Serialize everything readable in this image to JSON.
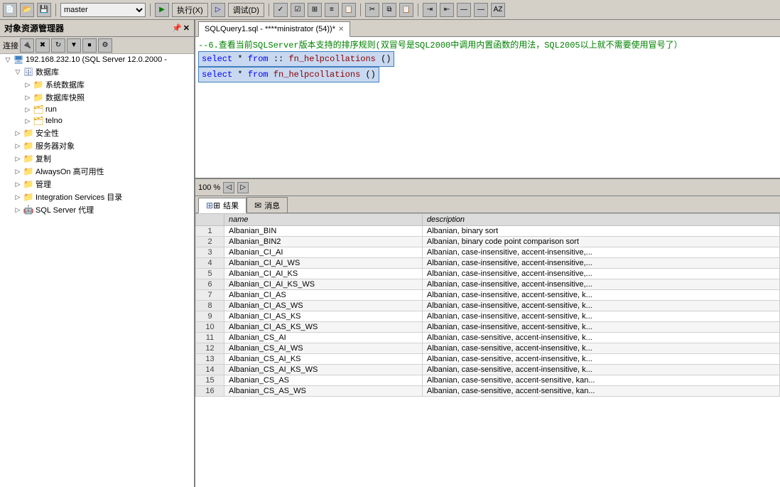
{
  "toolbar": {
    "db_select_value": "master",
    "execute_label": "执行(X)",
    "debug_label": "调试(D)"
  },
  "object_explorer": {
    "title": "对象资源管理器",
    "connect_label": "连接",
    "server": {
      "name": "192.168.232.10 (SQL Server 12.0.2000 -",
      "children": [
        {
          "label": "数据库",
          "expanded": true,
          "children": [
            {
              "label": "系统数据库",
              "expanded": false
            },
            {
              "label": "数据库快照",
              "expanded": false
            },
            {
              "label": "run",
              "expanded": false
            },
            {
              "label": "telno",
              "expanded": false
            }
          ]
        },
        {
          "label": "安全性",
          "expanded": false
        },
        {
          "label": "服务器对象",
          "expanded": false
        },
        {
          "label": "复制",
          "expanded": false
        },
        {
          "label": "AlwaysOn 高可用性",
          "expanded": false
        },
        {
          "label": "管理",
          "expanded": false
        },
        {
          "label": "Integration Services 目录",
          "expanded": false
        },
        {
          "label": "SQL Server 代理",
          "expanded": false
        }
      ]
    }
  },
  "editor": {
    "tab_label": "SQLQuery1.sql - ****ministrator (54))*",
    "comment_line": "--6.查看当前SQLServer版本支持的排序规则(双冒号是SQL2000中调用内置函数的用法，SQL2005以上就不需要使用冒号了）",
    "line1": "select * from ::fn_helpcollations()",
    "line2": "select * from fn_helpcollations()",
    "zoom": "100 %"
  },
  "results": {
    "tab_results": "结果",
    "tab_messages": "消息",
    "columns": {
      "row_num": "",
      "name": "name",
      "description": "description"
    },
    "rows": [
      {
        "num": "1",
        "name": "Albanian_BIN",
        "description": "Albanian, binary sort"
      },
      {
        "num": "2",
        "name": "Albanian_BIN2",
        "description": "Albanian, binary code point comparison sort"
      },
      {
        "num": "3",
        "name": "Albanian_CI_AI",
        "description": "Albanian, case-insensitive, accent-insensitive,..."
      },
      {
        "num": "4",
        "name": "Albanian_CI_AI_WS",
        "description": "Albanian, case-insensitive, accent-insensitive,..."
      },
      {
        "num": "5",
        "name": "Albanian_CI_AI_KS",
        "description": "Albanian, case-insensitive, accent-insensitive,..."
      },
      {
        "num": "6",
        "name": "Albanian_CI_AI_KS_WS",
        "description": "Albanian, case-insensitive, accent-insensitive,..."
      },
      {
        "num": "7",
        "name": "Albanian_CI_AS",
        "description": "Albanian, case-insensitive, accent-sensitive, k..."
      },
      {
        "num": "8",
        "name": "Albanian_CI_AS_WS",
        "description": "Albanian, case-insensitive, accent-sensitive, k..."
      },
      {
        "num": "9",
        "name": "Albanian_CI_AS_KS",
        "description": "Albanian, case-insensitive, accent-sensitive, k..."
      },
      {
        "num": "10",
        "name": "Albanian_CI_AS_KS_WS",
        "description": "Albanian, case-insensitive, accent-sensitive, k..."
      },
      {
        "num": "11",
        "name": "Albanian_CS_AI",
        "description": "Albanian, case-sensitive, accent-insensitive, k..."
      },
      {
        "num": "12",
        "name": "Albanian_CS_AI_WS",
        "description": "Albanian, case-sensitive, accent-insensitive, k..."
      },
      {
        "num": "13",
        "name": "Albanian_CS_AI_KS",
        "description": "Albanian, case-sensitive, accent-insensitive, k..."
      },
      {
        "num": "14",
        "name": "Albanian_CS_AI_KS_WS",
        "description": "Albanian, case-sensitive, accent-insensitive, k..."
      },
      {
        "num": "15",
        "name": "Albanian_CS_AS",
        "description": "Albanian, case-sensitive, accent-sensitive, kan..."
      },
      {
        "num": "16",
        "name": "Albanian_CS_AS_WS",
        "description": "Albanian, case-sensitive, accent-sensitive, kan..."
      }
    ]
  }
}
